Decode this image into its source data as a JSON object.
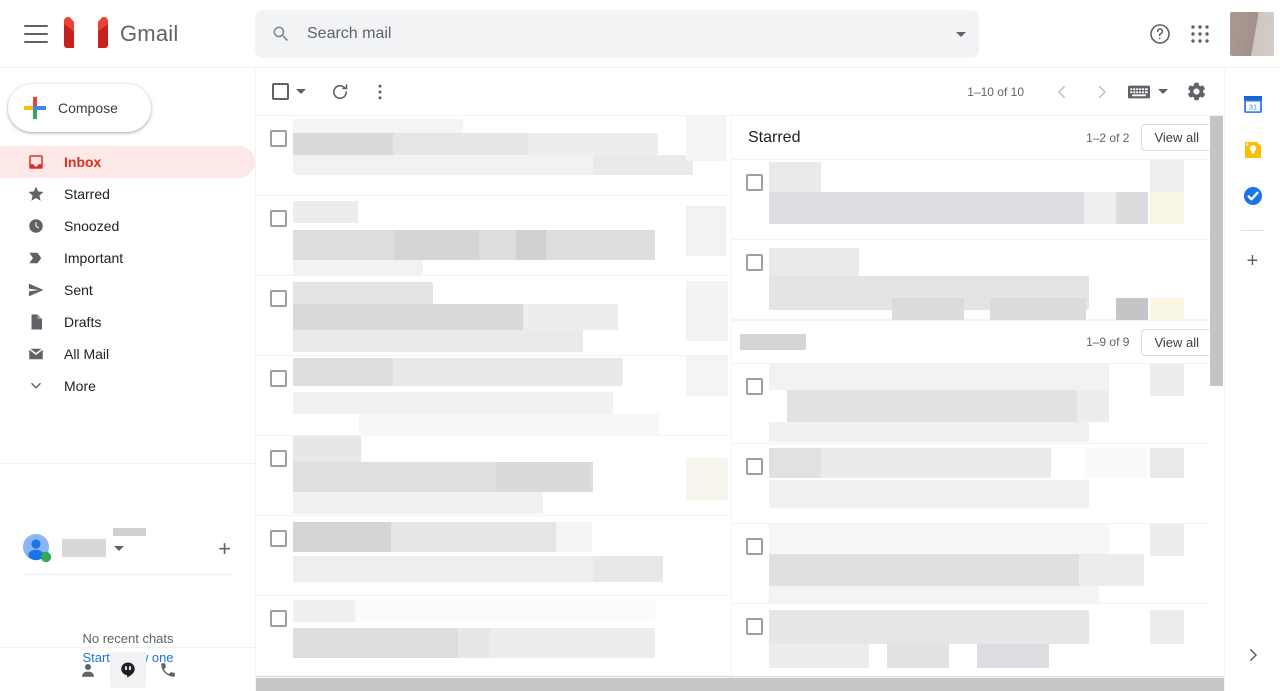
{
  "app": {
    "title": "Gmail"
  },
  "header": {
    "menu_icon": "hamburger-icon",
    "logo_icon": "gmail-logo-icon",
    "brand": "Gmail",
    "search": {
      "placeholder": "Search mail",
      "value": "",
      "icon": "search-icon",
      "options_icon": "chevron-down-icon"
    },
    "support_icon": "question-mark-icon",
    "apps_icon": "google-apps-grid-icon",
    "avatar": "account-avatar-redacted"
  },
  "sidebar": {
    "compose": {
      "label": "Compose",
      "icon": "plus-icon"
    },
    "items": [
      {
        "label": "Inbox",
        "icon": "inbox-icon",
        "active": true
      },
      {
        "label": "Starred",
        "icon": "star-icon",
        "active": false
      },
      {
        "label": "Snoozed",
        "icon": "clock-icon",
        "active": false
      },
      {
        "label": "Important",
        "icon": "label-important-icon",
        "active": false
      },
      {
        "label": "Sent",
        "icon": "send-icon",
        "active": false
      },
      {
        "label": "Drafts",
        "icon": "draft-file-icon",
        "active": false
      },
      {
        "label": "All Mail",
        "icon": "mail-stack-icon",
        "active": false
      },
      {
        "label": "More",
        "icon": "chevron-down-icon",
        "active": false
      }
    ],
    "chat": {
      "status_icon": "online-status-dot",
      "name_redacted": true,
      "dropdown_icon": "chevron-down-icon",
      "add_icon": "plus-icon",
      "empty_text": "No recent chats",
      "start_link": "Start a new one",
      "footer_icons": [
        "contacts-icon",
        "hangouts-icon",
        "phone-icon"
      ],
      "footer_selected_index": 1
    }
  },
  "toolbar": {
    "select_all": {
      "icon": "checkbox-icon",
      "dropdown_icon": "chevron-down-icon"
    },
    "refresh_icon": "refresh-icon",
    "more_icon": "more-vertical-icon",
    "pagination": "1–10 of 10",
    "prev_icon": "chevron-left-icon",
    "next_icon": "chevron-right-icon",
    "input_tools_icon": "keyboard-icon",
    "input_tools_caret": "chevron-down-icon",
    "settings_icon": "gear-icon"
  },
  "main": {
    "left_list": {
      "rows": [
        {
          "checkbox": true,
          "redacted": true
        },
        {
          "checkbox": true,
          "redacted": true
        },
        {
          "checkbox": true,
          "redacted": true
        },
        {
          "checkbox": true,
          "redacted": true
        },
        {
          "checkbox": true,
          "redacted": true
        },
        {
          "checkbox": true,
          "redacted": true
        },
        {
          "checkbox": true,
          "redacted": true
        }
      ]
    },
    "panels": [
      {
        "title": "Starred",
        "title_redacted": false,
        "count": "1–2 of 2",
        "view_all": "View all",
        "rows": [
          {
            "checkbox": true,
            "redacted": true
          },
          {
            "checkbox": true,
            "redacted": true
          }
        ]
      },
      {
        "title": "",
        "title_redacted": true,
        "count": "1–9 of 9",
        "view_all": "View all",
        "rows": [
          {
            "checkbox": true,
            "redacted": true
          },
          {
            "checkbox": true,
            "redacted": true
          },
          {
            "checkbox": true,
            "redacted": true
          },
          {
            "checkbox": true,
            "redacted": true
          }
        ]
      }
    ]
  },
  "rail": {
    "items": [
      {
        "name": "google-calendar-icon",
        "color": "#4285f4"
      },
      {
        "name": "google-keep-icon",
        "color": "#fbbc04"
      },
      {
        "name": "google-tasks-icon",
        "color": "#1a73e8"
      }
    ],
    "add_label": "+",
    "expand_icon": "chevron-right-icon"
  },
  "colors": {
    "gmail_red": "#d93025",
    "active_pill": "#fce8e6",
    "link_blue": "#1a73e8",
    "text_primary": "#202124",
    "text_secondary": "#5f6368",
    "divider": "#f1f3f4"
  }
}
